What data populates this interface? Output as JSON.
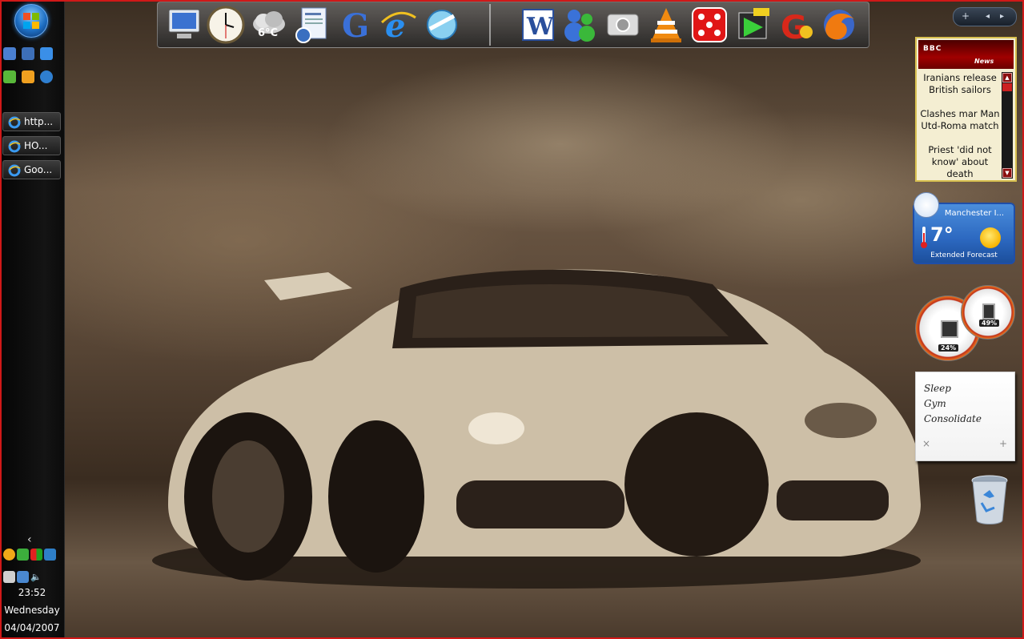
{
  "screen": {
    "accent": "#d01818"
  },
  "sidebar": {
    "quick_launch": [
      {
        "icon": "show-desktop-icon",
        "color": "#4a7fd0"
      },
      {
        "icon": "switch-windows-icon",
        "color": "#3d6fb8"
      },
      {
        "icon": "internet-explorer-icon",
        "color": "#3a8fe8"
      },
      {
        "icon": "messenger-icon",
        "color": "#58b83a"
      },
      {
        "icon": "media-player-icon",
        "color": "#f0a020"
      },
      {
        "icon": "browser-icon",
        "color": "#2f7fd0"
      }
    ],
    "taskbar_buttons": [
      {
        "label": "http..."
      },
      {
        "label": "HO..."
      },
      {
        "label": "Goo..."
      }
    ],
    "tray_toggle": "‹",
    "clock": {
      "time": "23:52",
      "day": "Wednesday",
      "date": "04/04/2007"
    }
  },
  "dock": {
    "icons": [
      "my-computer-icon",
      "clock-icon",
      "weather-icon",
      "documents-icon",
      "google-icon",
      "internet-explorer-icon",
      "network-icon",
      "word-icon",
      "messenger-icon",
      "camera-icon",
      "vlc-icon",
      "dice-game-icon",
      "media-icon",
      "google-talk-icon",
      "firefox-icon"
    ],
    "weather_temp": "6°C"
  },
  "pager": {
    "add": "+",
    "prev": "◂",
    "next": "▸"
  },
  "bbc_gadget": {
    "logo": "BBC",
    "brand": "News",
    "headlines": [
      "Iranians release British sailors",
      "Clashes mar Man Utd-Roma match",
      "Priest 'did not know' about death"
    ]
  },
  "weather_gadget": {
    "city": "Manchester I...",
    "temperature": "7°",
    "link": "Extended Forecast"
  },
  "meters": {
    "cpu": "24%",
    "memory": "49%"
  },
  "notes": {
    "lines": [
      "Sleep",
      "Gym",
      "Consolidate"
    ],
    "delete": "×",
    "add": "+"
  }
}
